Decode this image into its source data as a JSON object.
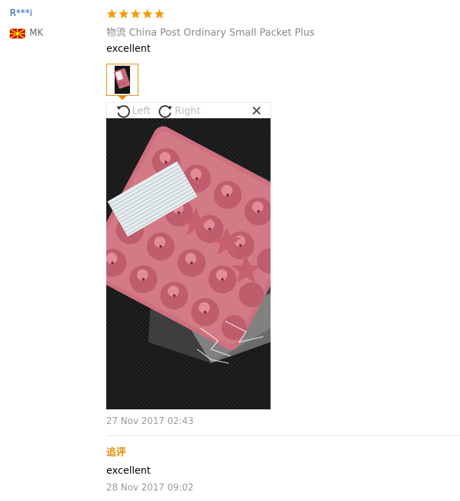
{
  "reviewer": {
    "name": "R***i",
    "country_code": "MK",
    "flag_colors": {
      "field": "#d20000",
      "sun": "#ffe600"
    }
  },
  "review": {
    "rating": 5,
    "max_rating": 5,
    "star_color": "#f29d0c",
    "logistics_label": "物流",
    "logistics_value": "China Post Ordinary Small Packet Plus",
    "text": "excellent",
    "date": "27 Nov 2017 02:43"
  },
  "photo_viewer": {
    "rotate_left_label": "Left",
    "rotate_right_label": "Right",
    "icons": {
      "rotate_left": "rotate-left-icon",
      "rotate_right": "rotate-right-icon",
      "close": "close-icon"
    },
    "accent_color": "#e68a00"
  },
  "followup": {
    "label": "追评",
    "text": "excellent",
    "date": "28 Nov 2017 09:02"
  }
}
